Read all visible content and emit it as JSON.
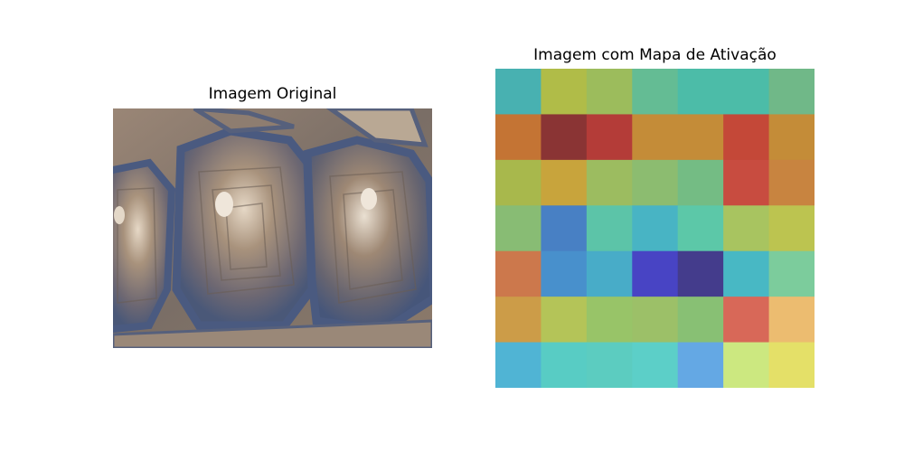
{
  "panels": {
    "left_title": "Imagem Original",
    "right_title": "Imagem com Mapa de Ativação"
  },
  "image_description_colors": {
    "shell_base": "#8a7a6e",
    "seam_blue": "#4a5a7e",
    "highlight": "#e8dccd"
  },
  "chart_data": {
    "type": "heatmap",
    "title": "Imagem com Mapa de Ativação",
    "rows": 7,
    "cols": 7,
    "grid": false,
    "axes": "off",
    "cell_colors": [
      [
        "#48b1b1",
        "#b0bc48",
        "#9cbc5c",
        "#64bc94",
        "#4cbca8",
        "#4cbca8",
        "#70b888"
      ],
      [
        "#c47434",
        "#8a3434",
        "#b43c38",
        "#c48c38",
        "#c48c38",
        "#c44838",
        "#c48c38"
      ],
      [
        "#a8b84c",
        "#c8a43c",
        "#9cbc60",
        "#8cbc70",
        "#74bc84",
        "#c84c40",
        "#c88440"
      ],
      [
        "#88bc74",
        "#4880c4",
        "#5cc4a8",
        "#48b4c4",
        "#5cc8a8",
        "#a8c460",
        "#bcc450"
      ],
      [
        "#cc784c",
        "#4890cc",
        "#48acc8",
        "#4844c4",
        "#443c8c",
        "#48b8c4",
        "#7ccc9c"
      ],
      [
        "#cc9c48",
        "#b4c458",
        "#98c468",
        "#9cc068",
        "#88c074",
        "#d86858",
        "#ecbc70"
      ],
      [
        "#50b4d4",
        "#58ccc4",
        "#5cccc0",
        "#5ccfc8",
        "#64a8e4",
        "#cce880",
        "#e4e068"
      ]
    ]
  }
}
